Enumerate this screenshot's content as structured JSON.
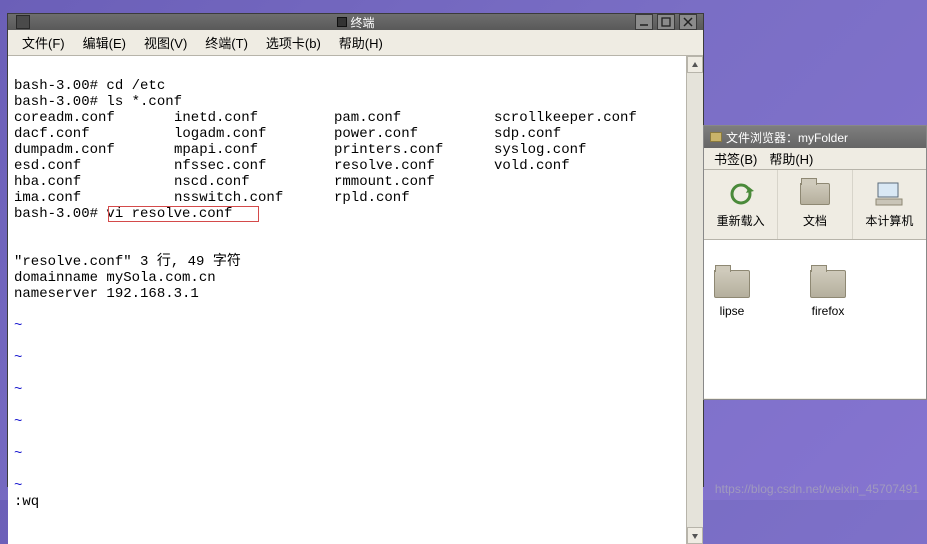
{
  "terminal": {
    "title": "终端",
    "menus": {
      "file": "文件(F)",
      "edit": "编辑(E)",
      "view": "视图(V)",
      "terminal": "终端(T)",
      "tabs": "选项卡(b)",
      "help": "帮助(H)"
    },
    "prompt1": "bash-3.00# cd /etc",
    "prompt2": "bash-3.00# ls *.conf",
    "ls_cols": {
      "c1": "coreadm.conf\ndacf.conf\ndumpadm.conf\nesd.conf\nhba.conf\nima.conf",
      "c2": "inetd.conf\nlogadm.conf\nmpapi.conf\nnfssec.conf\nnscd.conf\nnsswitch.conf",
      "c3": "pam.conf\npower.conf\nprinters.conf\nresolve.conf\nrmmount.conf\nrpld.conf",
      "c4": "scrollkeeper.conf\nsdp.conf\nsyslog.conf\nvold.conf"
    },
    "prompt3_pre": "bash-3.00# ",
    "prompt3_boxed": "vi resolve.conf",
    "file_summary": "\"resolve.conf\" 3 行, 49 字符",
    "file_line1": "domainname mySola.com.cn",
    "file_line2": "nameserver 192.168.3.1",
    "tilde": "~",
    "wq": ":wq"
  },
  "filebrowser": {
    "title": "文件浏览器：myFolder",
    "menus": {
      "bookmarks": "书签(B)",
      "help": "帮助(H)"
    },
    "toolbar": {
      "reload": "重新载入",
      "docs": "文档",
      "computer": "本计算机"
    },
    "items": {
      "lipse": "lipse",
      "firefox": "firefox"
    }
  },
  "watermark": "https://blog.csdn.net/weixin_45707491"
}
